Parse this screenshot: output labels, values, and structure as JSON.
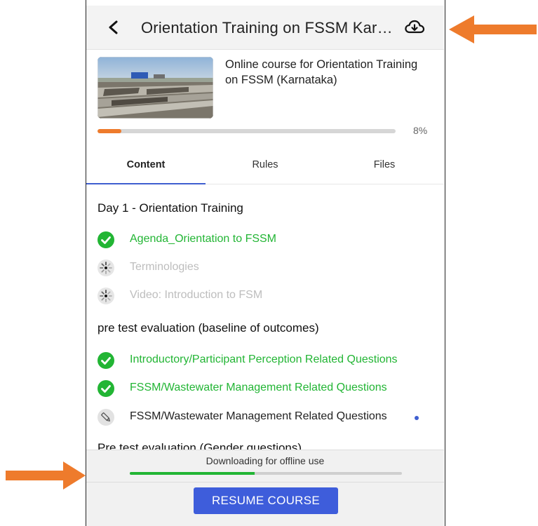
{
  "header": {
    "back_icon": "chevron-left-icon",
    "title": "Orientation Training on FSSM Karnataka",
    "download_icon": "cloud-download-icon"
  },
  "course": {
    "description": "Online course for Orientation Training on FSSM (Karnataka)",
    "progress_percent": 8,
    "progress_label": "8%"
  },
  "tabs": [
    {
      "label": "Content",
      "active": true
    },
    {
      "label": "Rules",
      "active": false
    },
    {
      "label": "Files",
      "active": false
    }
  ],
  "sections": [
    {
      "title": "Day 1 - Orientation Training",
      "items": [
        {
          "label": "Agenda_Orientation to FSSM",
          "status": "completed"
        },
        {
          "label": "Terminologies",
          "status": "loading"
        },
        {
          "label": "Video: Introduction to FSM",
          "status": "loading"
        }
      ]
    },
    {
      "title": "pre test evaluation (baseline of outcomes)",
      "items": [
        {
          "label": "Introductory/Participant Perception Related Questions",
          "status": "completed"
        },
        {
          "label": "FSSM/Wastewater Management Related Questions",
          "status": "completed"
        },
        {
          "label": "FSSM/Wastewater Management Related Questions",
          "status": "editable"
        }
      ]
    },
    {
      "title": "Pre test evaluation (Gender questions)",
      "items": []
    }
  ],
  "bottom": {
    "download_status": "Downloading for offline use",
    "download_progress_percent": 46,
    "resume_label": "RESUME COURSE"
  },
  "colors": {
    "accent": "#3e5ddb",
    "completed": "#22b534",
    "progress": "#ee7b2c",
    "annotation_arrow": "#ee7b2c"
  }
}
